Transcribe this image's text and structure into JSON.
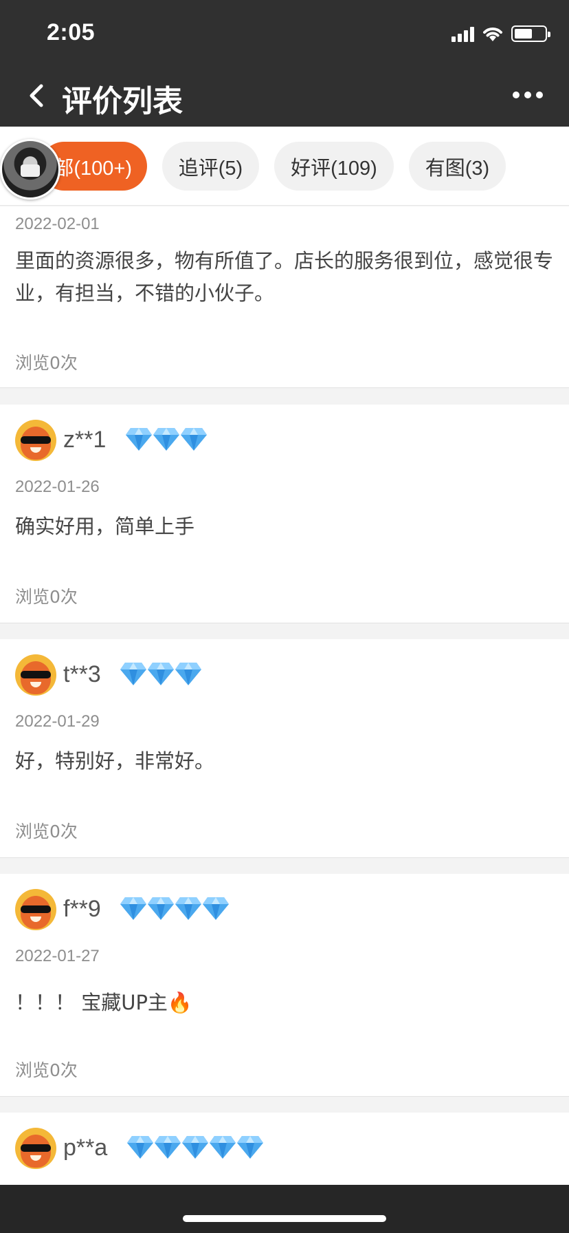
{
  "status_bar": {
    "time": "2:05",
    "icons": [
      "signal-icon",
      "wifi-icon",
      "battery-icon"
    ]
  },
  "nav": {
    "title": "评价列表",
    "back_icon": "back-chevron-icon",
    "more_icon": "more-dots-icon"
  },
  "filters": [
    {
      "label": "部(100+)",
      "active": true
    },
    {
      "label": "追评(5)",
      "active": false
    },
    {
      "label": "好评(109)",
      "active": false
    },
    {
      "label": "有图(3)",
      "active": false
    }
  ],
  "reviews": [
    {
      "date": "2022-02-01",
      "text": "里面的资源很多，物有所值了。店长的服务很到位，感觉很专业，有担当，不错的小伙子。",
      "views": "浏览0次"
    },
    {
      "user": "z**1",
      "diamonds": 3,
      "date": "2022-01-26",
      "text": "确实好用，简单上手",
      "views": "浏览0次"
    },
    {
      "user": "t**3",
      "diamonds": 3,
      "date": "2022-01-29",
      "text": "好，特别好，非常好。",
      "views": "浏览0次"
    },
    {
      "user": "f**9",
      "diamonds": 4,
      "date": "2022-01-27",
      "text": "！！！ 宝藏UP主🔥",
      "views": "浏览0次"
    },
    {
      "user": "p**a",
      "diamonds": 5
    }
  ],
  "colors": {
    "accent": "#ef6223",
    "header_bg": "#303030",
    "diamond": "#4aa8ee"
  }
}
